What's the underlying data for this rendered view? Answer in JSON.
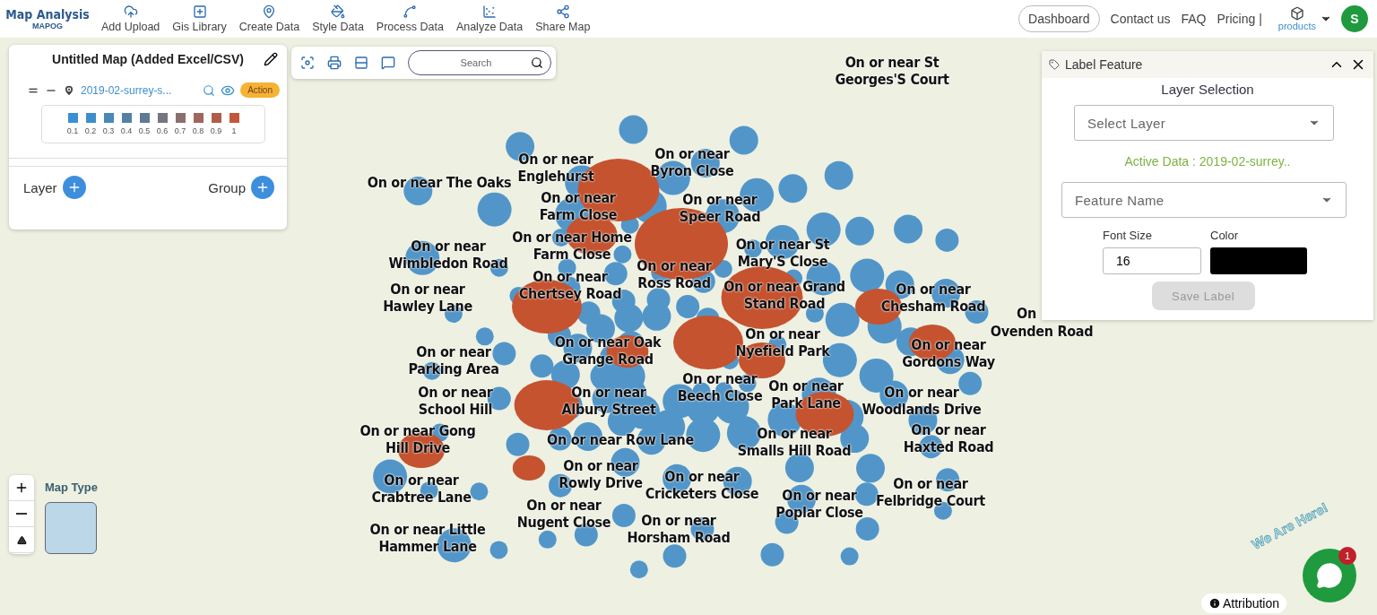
{
  "header": {
    "logo_title": "Map Analysis",
    "logo_subtitle": "MAPOG",
    "nav": [
      {
        "label": "Add Upload",
        "kind": "upload"
      },
      {
        "label": "Gis Library",
        "kind": "library"
      },
      {
        "label": "Create Data",
        "kind": "create"
      },
      {
        "label": "Style Data",
        "kind": "style"
      },
      {
        "label": "Process Data",
        "kind": "process"
      },
      {
        "label": "Analyze Data",
        "kind": "analyze"
      },
      {
        "label": "Share Map",
        "kind": "share"
      }
    ],
    "dashboard": "Dashboard",
    "links": [
      "Contact us",
      "FAQ",
      "Pricing |"
    ],
    "products": "products",
    "avatar": "S"
  },
  "map_panel": {
    "title": "Untitled Map (Added Excel/CSV)",
    "layer_name": "2019-02-surrey-s...",
    "action": "Action",
    "legend": [
      {
        "label": "0.1",
        "color": "#3a90d4"
      },
      {
        "label": "0.2",
        "color": "#3d8fcc"
      },
      {
        "label": "0.3",
        "color": "#4789b8"
      },
      {
        "label": "0.4",
        "color": "#5281a6"
      },
      {
        "label": "0.5",
        "color": "#607a94"
      },
      {
        "label": "0.6",
        "color": "#757680"
      },
      {
        "label": "0.7",
        "color": "#8a6f70"
      },
      {
        "label": "0.8",
        "color": "#9e665c"
      },
      {
        "label": "0.9",
        "color": "#b05c48"
      },
      {
        "label": "1",
        "color": "#c2563a"
      }
    ],
    "layer_label": "Layer",
    "group_label": "Group"
  },
  "toolbar": {
    "search_placeholder": "Search"
  },
  "label_panel": {
    "title": "Label Feature",
    "section": "Layer Selection",
    "layer_placeholder": "Select Layer",
    "active_data": "Active Data : 2019-02-surrey..",
    "feature_placeholder": "Feature Name",
    "font_size_label": "Font Size",
    "font_size": "16",
    "color_label": "Color",
    "color": "#000000",
    "save": "Save Label",
    "save_disabled": true
  },
  "map_labels": [
    "On or near St\nGeorges'S Court",
    "On or near\nEnglehurst",
    "On or near\nByron Close",
    "On or near The Oaks",
    "On or near\nFarm Close",
    "On or near\nSpeer Road",
    "On or near\nWimbledon Road",
    "On or near Home\nFarm Close",
    "On or near St\nMary'S Close",
    "On or near\nChertsey Road",
    "On or near\nRoss Road",
    "On or near\nHawley Lane",
    "On or near Grand\nStand Road",
    "On or near\nChesham Road",
    "On",
    "Ovenden Road",
    "On or near Oak\nGrange Road",
    "On or near\nNyefield Park",
    "On or near\nGordons Way",
    "On or near\nParking Area",
    "On or near\nBeech Close",
    "On or near\nSchool Hill",
    "On or near\nAlbury Street",
    "On or near\nPark Lane",
    "On or near\nWoodlands Drive",
    "On or near Gong\nHill Drive",
    "On or near Row Lane",
    "On or near\nSmalls Hill Road",
    "On or near\nHaxted Road",
    "On or near\nRowly Drive",
    "On or near\nCrabtree Lane",
    "On or near\nCricketers Close",
    "On or near\nPoplar Close",
    "On or near\nFelbridge Court",
    "On or near\nNugent Close",
    "On or near\nHorsham Road",
    "On or near Little\nHammer Lane"
  ],
  "map_type_label": "Map Type",
  "attribution": "Attribution",
  "chat": {
    "banner": "We Are Here!",
    "badge": "1"
  }
}
